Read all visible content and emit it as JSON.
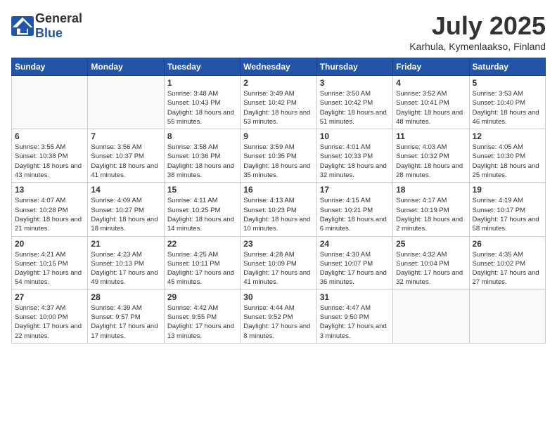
{
  "header": {
    "logo_general": "General",
    "logo_blue": "Blue",
    "month": "July 2025",
    "location": "Karhula, Kymenlaakso, Finland"
  },
  "days_of_week": [
    "Sunday",
    "Monday",
    "Tuesday",
    "Wednesday",
    "Thursday",
    "Friday",
    "Saturday"
  ],
  "weeks": [
    [
      {
        "day": "",
        "info": ""
      },
      {
        "day": "",
        "info": ""
      },
      {
        "day": "1",
        "info": "Sunrise: 3:48 AM\nSunset: 10:43 PM\nDaylight: 18 hours and 55 minutes."
      },
      {
        "day": "2",
        "info": "Sunrise: 3:49 AM\nSunset: 10:42 PM\nDaylight: 18 hours and 53 minutes."
      },
      {
        "day": "3",
        "info": "Sunrise: 3:50 AM\nSunset: 10:42 PM\nDaylight: 18 hours and 51 minutes."
      },
      {
        "day": "4",
        "info": "Sunrise: 3:52 AM\nSunset: 10:41 PM\nDaylight: 18 hours and 48 minutes."
      },
      {
        "day": "5",
        "info": "Sunrise: 3:53 AM\nSunset: 10:40 PM\nDaylight: 18 hours and 46 minutes."
      }
    ],
    [
      {
        "day": "6",
        "info": "Sunrise: 3:55 AM\nSunset: 10:38 PM\nDaylight: 18 hours and 43 minutes."
      },
      {
        "day": "7",
        "info": "Sunrise: 3:56 AM\nSunset: 10:37 PM\nDaylight: 18 hours and 41 minutes."
      },
      {
        "day": "8",
        "info": "Sunrise: 3:58 AM\nSunset: 10:36 PM\nDaylight: 18 hours and 38 minutes."
      },
      {
        "day": "9",
        "info": "Sunrise: 3:59 AM\nSunset: 10:35 PM\nDaylight: 18 hours and 35 minutes."
      },
      {
        "day": "10",
        "info": "Sunrise: 4:01 AM\nSunset: 10:33 PM\nDaylight: 18 hours and 32 minutes."
      },
      {
        "day": "11",
        "info": "Sunrise: 4:03 AM\nSunset: 10:32 PM\nDaylight: 18 hours and 28 minutes."
      },
      {
        "day": "12",
        "info": "Sunrise: 4:05 AM\nSunset: 10:30 PM\nDaylight: 18 hours and 25 minutes."
      }
    ],
    [
      {
        "day": "13",
        "info": "Sunrise: 4:07 AM\nSunset: 10:28 PM\nDaylight: 18 hours and 21 minutes."
      },
      {
        "day": "14",
        "info": "Sunrise: 4:09 AM\nSunset: 10:27 PM\nDaylight: 18 hours and 18 minutes."
      },
      {
        "day": "15",
        "info": "Sunrise: 4:11 AM\nSunset: 10:25 PM\nDaylight: 18 hours and 14 minutes."
      },
      {
        "day": "16",
        "info": "Sunrise: 4:13 AM\nSunset: 10:23 PM\nDaylight: 18 hours and 10 minutes."
      },
      {
        "day": "17",
        "info": "Sunrise: 4:15 AM\nSunset: 10:21 PM\nDaylight: 18 hours and 6 minutes."
      },
      {
        "day": "18",
        "info": "Sunrise: 4:17 AM\nSunset: 10:19 PM\nDaylight: 18 hours and 2 minutes."
      },
      {
        "day": "19",
        "info": "Sunrise: 4:19 AM\nSunset: 10:17 PM\nDaylight: 17 hours and 58 minutes."
      }
    ],
    [
      {
        "day": "20",
        "info": "Sunrise: 4:21 AM\nSunset: 10:15 PM\nDaylight: 17 hours and 54 minutes."
      },
      {
        "day": "21",
        "info": "Sunrise: 4:23 AM\nSunset: 10:13 PM\nDaylight: 17 hours and 49 minutes."
      },
      {
        "day": "22",
        "info": "Sunrise: 4:25 AM\nSunset: 10:11 PM\nDaylight: 17 hours and 45 minutes."
      },
      {
        "day": "23",
        "info": "Sunrise: 4:28 AM\nSunset: 10:09 PM\nDaylight: 17 hours and 41 minutes."
      },
      {
        "day": "24",
        "info": "Sunrise: 4:30 AM\nSunset: 10:07 PM\nDaylight: 17 hours and 36 minutes."
      },
      {
        "day": "25",
        "info": "Sunrise: 4:32 AM\nSunset: 10:04 PM\nDaylight: 17 hours and 32 minutes."
      },
      {
        "day": "26",
        "info": "Sunrise: 4:35 AM\nSunset: 10:02 PM\nDaylight: 17 hours and 27 minutes."
      }
    ],
    [
      {
        "day": "27",
        "info": "Sunrise: 4:37 AM\nSunset: 10:00 PM\nDaylight: 17 hours and 22 minutes."
      },
      {
        "day": "28",
        "info": "Sunrise: 4:39 AM\nSunset: 9:57 PM\nDaylight: 17 hours and 17 minutes."
      },
      {
        "day": "29",
        "info": "Sunrise: 4:42 AM\nSunset: 9:55 PM\nDaylight: 17 hours and 13 minutes."
      },
      {
        "day": "30",
        "info": "Sunrise: 4:44 AM\nSunset: 9:52 PM\nDaylight: 17 hours and 8 minutes."
      },
      {
        "day": "31",
        "info": "Sunrise: 4:47 AM\nSunset: 9:50 PM\nDaylight: 17 hours and 3 minutes."
      },
      {
        "day": "",
        "info": ""
      },
      {
        "day": "",
        "info": ""
      }
    ]
  ]
}
